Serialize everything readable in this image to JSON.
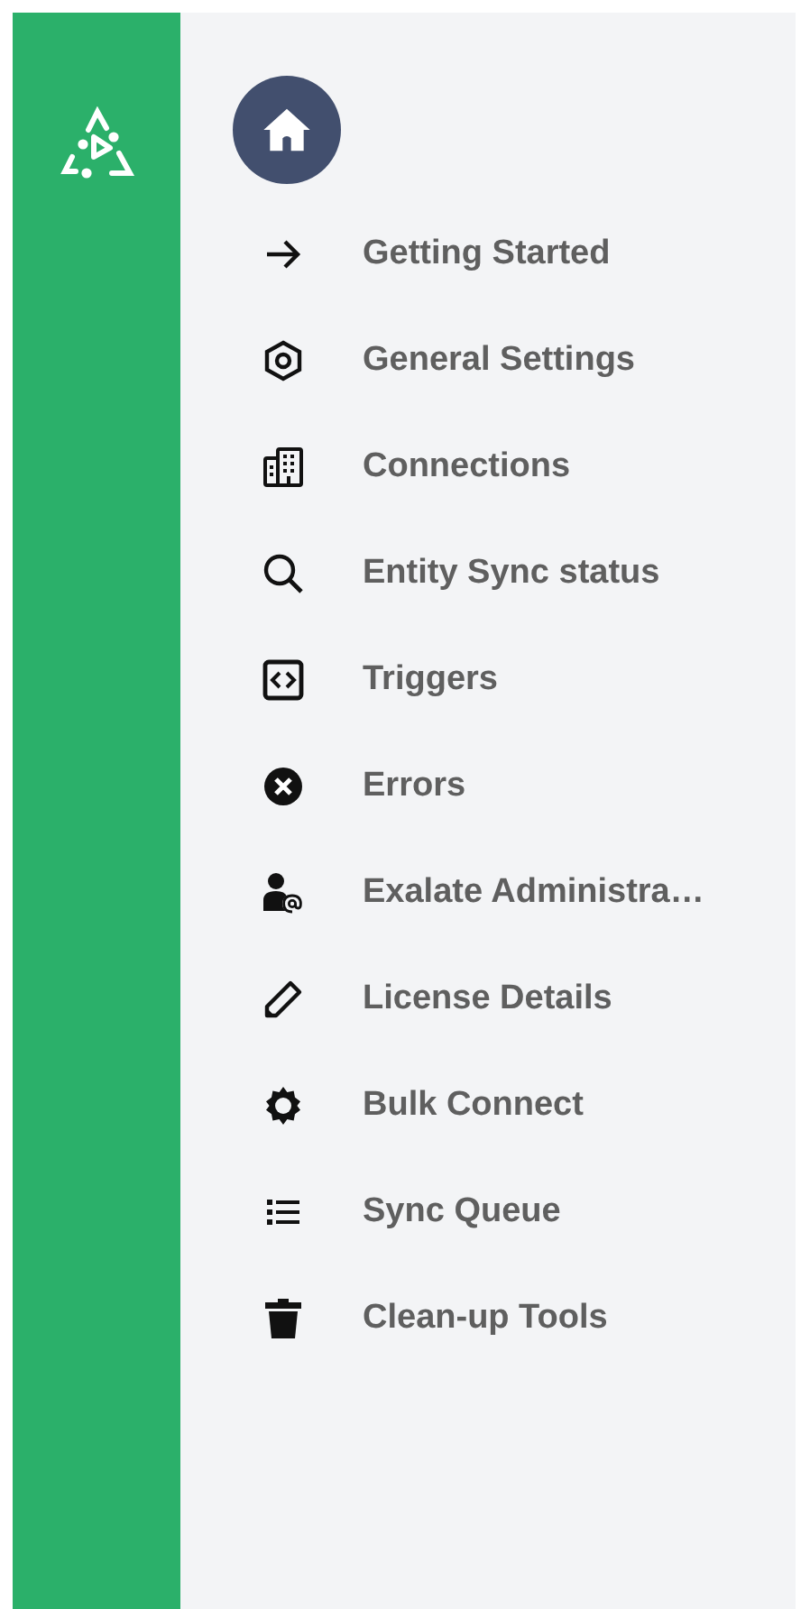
{
  "menu": [
    {
      "label": "Getting Started"
    },
    {
      "label": "General Settings"
    },
    {
      "label": "Connections"
    },
    {
      "label": "Entity Sync status"
    },
    {
      "label": "Triggers"
    },
    {
      "label": "Errors"
    },
    {
      "label": "Exalate Administra…"
    },
    {
      "label": "License Details"
    },
    {
      "label": "Bulk Connect"
    },
    {
      "label": "Sync Queue"
    },
    {
      "label": "Clean-up Tools"
    }
  ]
}
